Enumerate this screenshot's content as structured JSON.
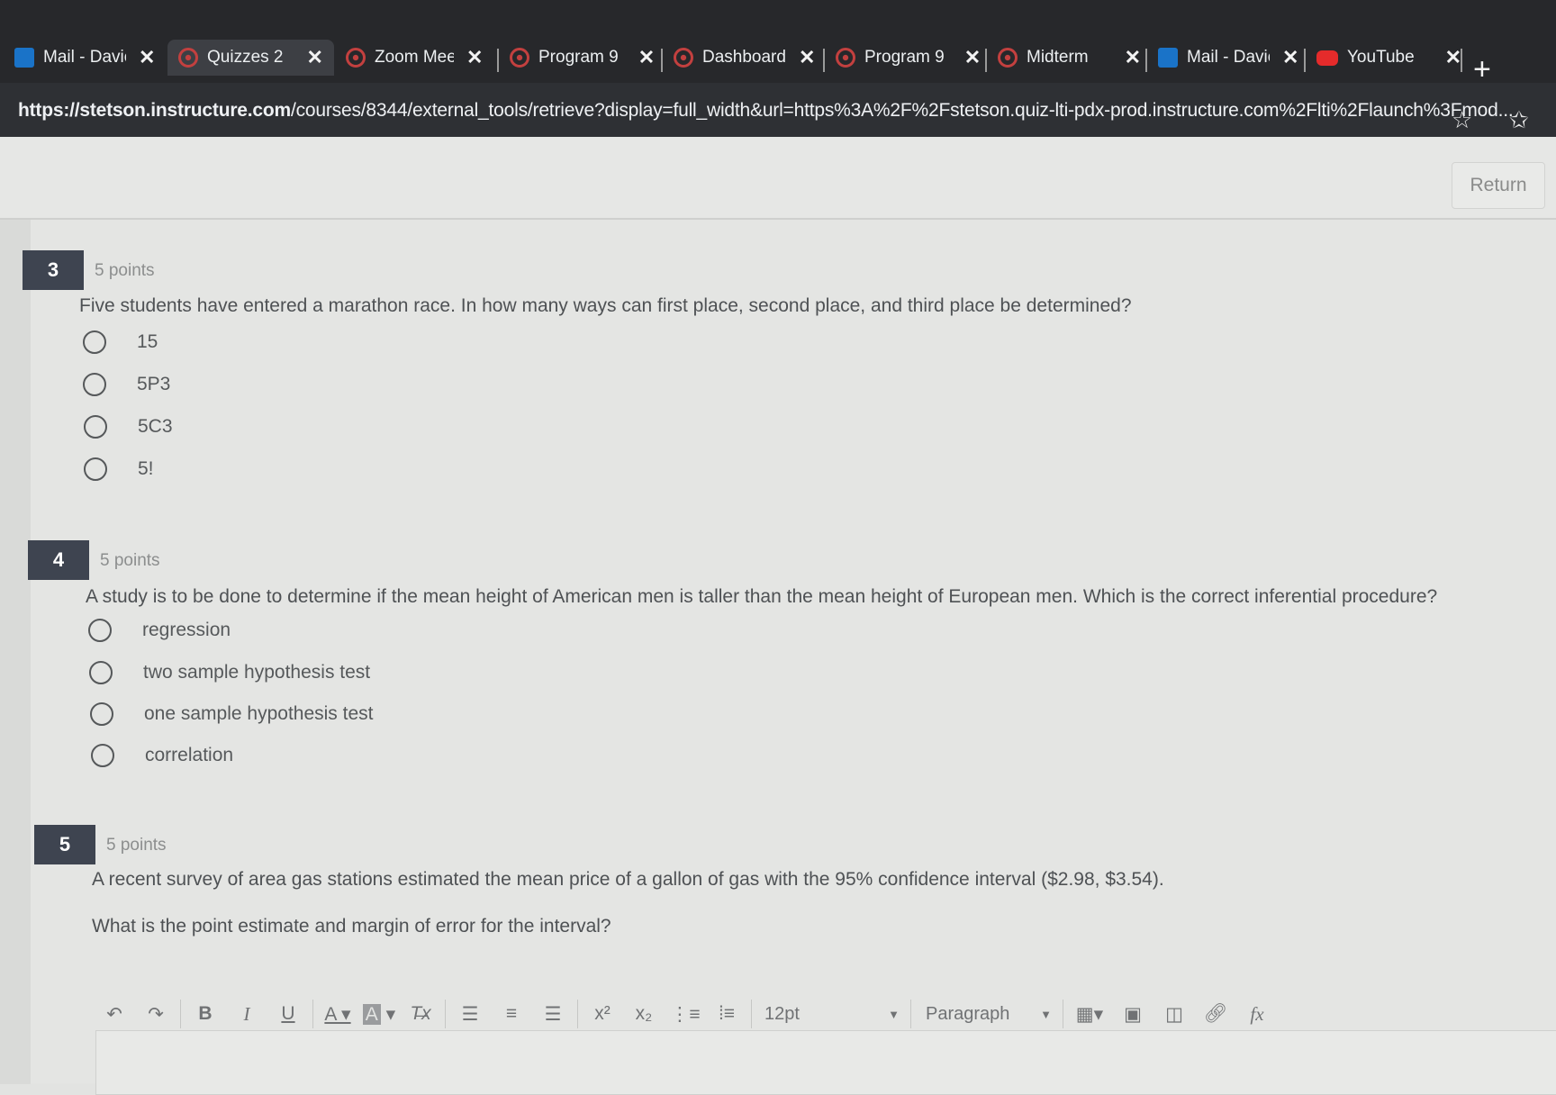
{
  "browser": {
    "tabs": [
      {
        "title": "Mail - Davic",
        "icon": "outlook-icon"
      },
      {
        "title": "Quizzes 2",
        "icon": "canvas-icon",
        "active": true
      },
      {
        "title": "Zoom Mee",
        "icon": "canvas-icon"
      },
      {
        "title": "Program 9",
        "icon": "canvas-icon"
      },
      {
        "title": "Dashboard",
        "icon": "canvas-icon"
      },
      {
        "title": "Program 9",
        "icon": "canvas-icon"
      },
      {
        "title": "Midterm",
        "icon": "canvas-icon"
      },
      {
        "title": "Mail - Davic",
        "icon": "outlook-icon"
      },
      {
        "title": "YouTube",
        "icon": "youtube-icon"
      }
    ],
    "url_host": "https://stetson.instructure.com",
    "url_path": "/courses/8344/external_tools/retrieve?display=full_width&url=https%3A%2F%2Fstetson.quiz-lti-pdx-prod.instructure.com%2Flti%2Flaunch%3Fmod..."
  },
  "header": {
    "return_label": "Return"
  },
  "questions": [
    {
      "number": "3",
      "points": "5 points",
      "text": "Five students have entered a marathon race.  In how many ways can first place, second place, and third place be determined?",
      "options": [
        "15",
        "5P3",
        "5C3",
        "5!"
      ]
    },
    {
      "number": "4",
      "points": "5 points",
      "text": "A study is to be done to determine if the mean height of American men is taller than the mean height of European men.  Which is the correct inferential procedure?",
      "options": [
        "regression",
        "two sample hypothesis test",
        "one sample hypothesis test",
        "correlation"
      ]
    },
    {
      "number": "5",
      "points": "5 points",
      "text": "A recent survey of area gas stations estimated the mean price of a gallon of gas with the 95% confidence interval ($2.98, $3.54).",
      "text2": "What is the point estimate and margin of error for the interval?"
    }
  ],
  "editor": {
    "font_size": "12pt",
    "block_format": "Paragraph"
  }
}
